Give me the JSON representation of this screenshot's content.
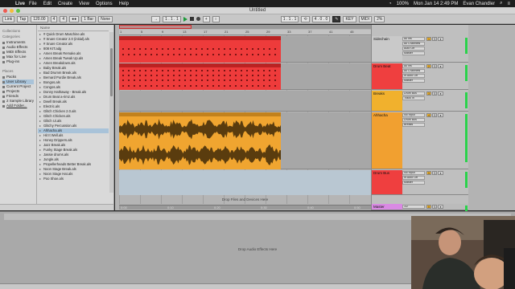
{
  "menubar": {
    "app": "Live",
    "items": [
      "File",
      "Edit",
      "Create",
      "View",
      "Options",
      "Help"
    ],
    "battery": "100%",
    "clock": "Mon Jan 14  2:49 PM",
    "user": "Evan Chandler"
  },
  "window": {
    "title": "Untitled"
  },
  "controlbar": {
    "link": "Link",
    "tap": "Tap",
    "tempo": "120.00",
    "sig_num": "4",
    "sig_den": "4",
    "metro": "1 Bar",
    "quant": "None",
    "position": "1 . 1 . 1",
    "loop_start": "1 . 1 . 1",
    "loop_len": "4 . 0 . 0"
  },
  "browser": {
    "collections_header": "Collections",
    "categories_header": "Categories",
    "categories": [
      "Instruments",
      "Audio Effects",
      "MIDI Effects",
      "Max for Live",
      "Plug-ins"
    ],
    "places_header": "Places",
    "places": [
      "Packs",
      "User Library",
      "Current Project",
      "Projects",
      "Friends",
      "2 Sample Library",
      "Add Folder..."
    ],
    "selected_place": "User Library",
    "name_header": "Name",
    "files": [
      "# Quick Drum Maschine.als",
      "# Snare Creator 2.0 (initial).als",
      "# Snare Creator.als",
      "808 KIT.adg",
      "Amen Break Remake.als",
      "Amen Break Tweak Up.als",
      "Amen Breakdown.als",
      "Baby Break.als",
      "Bad Drumm Break.als",
      "Bernard Purdie Break.als",
      "Bongos.als",
      "Congos.als",
      "Donny Hathaway - Break.als",
      "Drum Beat a-rimz.als",
      "Dwell Break.als",
      "Electric.als",
      "Glitch Chicken 2.0.als",
      "Glitch Chicken.als",
      "Glitch Ui.als",
      "Glitchy Percussion.als",
      "Ahhacha.als",
      "Hit It Well.als",
      "Honey Drippers.als",
      "Jazz Break.als",
      "Funky Stage Break.als",
      "Jassie drums.als",
      "Jungle.als",
      "Propellerheads Better Break.als",
      "Noon Stage Break.als",
      "Noon Stage Hat.als",
      "Poo Shoe.als"
    ],
    "selected_file": "Ahhacha.als"
  },
  "arrangement": {
    "bars": [
      "1",
      "5",
      "9",
      "13",
      "17",
      "21",
      "25",
      "29",
      "33",
      "37",
      "41",
      "45"
    ],
    "drop_text": "Drop Files and Devices Here",
    "time_marks": [
      "0:00",
      "0:10",
      "0:20",
      "0:30",
      "0:40",
      "0:50"
    ]
  },
  "tracks": [
    {
      "id": "sidechain",
      "name": "Sidechain",
      "io": [
        "All Ins",
        "All Channels",
        "Auto Off",
        "Master"
      ],
      "num": "1",
      "color": "#c9c9c9"
    },
    {
      "id": "drum",
      "name": "Drum Beat",
      "io": [
        "All Ins",
        "All Channels",
        "In Auto Off",
        "Master"
      ],
      "num": "2",
      "color": "#ef3f3f"
    },
    {
      "id": "breaks",
      "name": "Breaks",
      "io": [
        "Drum Bus",
        "Track In"
      ],
      "num": "3",
      "color": "#f1b12d"
    },
    {
      "id": "ahhacha",
      "name": "Ahhacha",
      "io": [
        "No Input",
        "Drum Bus",
        "Breaks"
      ],
      "num": "4",
      "color": "#f1a030"
    },
    {
      "id": "drumbus",
      "name": "Drum Bus",
      "io": [
        "No Input",
        "In Auto Off",
        "Master"
      ],
      "num": "5",
      "color": "#ef3f3f"
    },
    {
      "id": "master",
      "name": "Master",
      "io": [
        "1/2"
      ],
      "num": "0",
      "color": "#d98ae3"
    }
  ],
  "deviceview": {
    "drop_text": "Drop Audio Effects Here",
    "track_name": "Drum Bus"
  }
}
